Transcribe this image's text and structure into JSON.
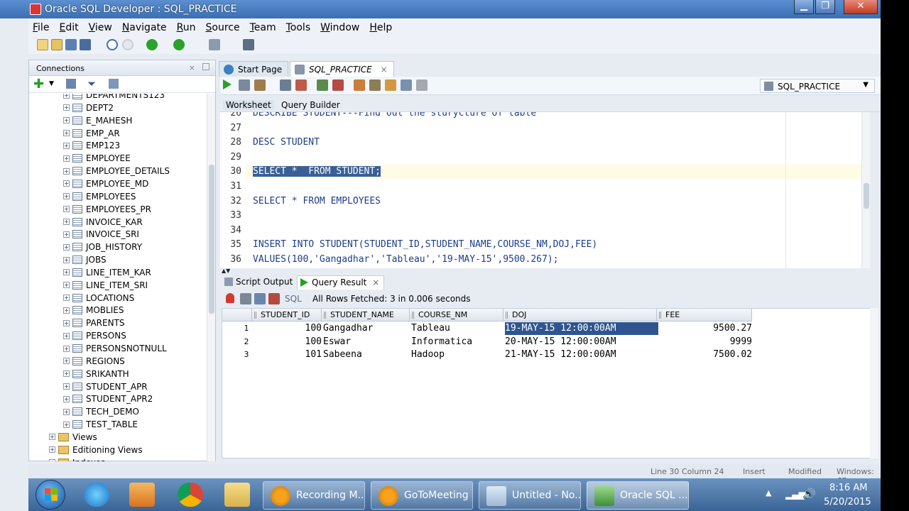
{
  "window": {
    "title": "Oracle SQL Developer : SQL_PRACTICE",
    "minimize": "▁",
    "maximize": "❐",
    "close": "✕"
  },
  "menu": [
    "File",
    "Edit",
    "View",
    "Navigate",
    "Run",
    "Source",
    "Team",
    "Tools",
    "Window",
    "Help"
  ],
  "connections": {
    "title": "Connections",
    "tree": [
      {
        "label": "DEPARTMENTS123",
        "type": "table"
      },
      {
        "label": "DEPT2",
        "type": "table"
      },
      {
        "label": "E_MAHESH",
        "type": "table"
      },
      {
        "label": "EMP_AR",
        "type": "table"
      },
      {
        "label": "EMP123",
        "type": "table"
      },
      {
        "label": "EMPLOYEE",
        "type": "table"
      },
      {
        "label": "EMPLOYEE_DETAILS",
        "type": "table"
      },
      {
        "label": "EMPLOYEE_MD",
        "type": "table"
      },
      {
        "label": "EMPLOYEES",
        "type": "table"
      },
      {
        "label": "EMPLOYEES_PR",
        "type": "table"
      },
      {
        "label": "INVOICE_KAR",
        "type": "table"
      },
      {
        "label": "INVOICE_SRI",
        "type": "table"
      },
      {
        "label": "JOB_HISTORY",
        "type": "table"
      },
      {
        "label": "JOBS",
        "type": "table"
      },
      {
        "label": "LINE_ITEM_KAR",
        "type": "table"
      },
      {
        "label": "LINE_ITEM_SRI",
        "type": "table"
      },
      {
        "label": "LOCATIONS",
        "type": "table"
      },
      {
        "label": "MOBLIES",
        "type": "table"
      },
      {
        "label": "PARENTS",
        "type": "table"
      },
      {
        "label": "PERSONS",
        "type": "table"
      },
      {
        "label": "PERSONSNOTNULL",
        "type": "table"
      },
      {
        "label": "REGIONS",
        "type": "table"
      },
      {
        "label": "SRIKANTH",
        "type": "table"
      },
      {
        "label": "STUDENT_APR",
        "type": "table"
      },
      {
        "label": "STUDENT_APR2",
        "type": "table"
      },
      {
        "label": "TECH_DEMO",
        "type": "table"
      },
      {
        "label": "TEST_TABLE",
        "type": "table"
      },
      {
        "label": "Views",
        "type": "folder"
      },
      {
        "label": "Editioning Views",
        "type": "folder"
      },
      {
        "label": "Indexes",
        "type": "folder"
      }
    ]
  },
  "tabs": [
    {
      "label": "Start Page"
    },
    {
      "label": "SQL_PRACTICE"
    }
  ],
  "connection_selector": "SQL_PRACTICE",
  "subtabs": {
    "worksheet": "Worksheet",
    "query_builder": "Query Builder"
  },
  "editor": {
    "lines": [
      {
        "n": "26",
        "text": "DESCRIBE STUDENT---Find out the sturycture of table"
      },
      {
        "n": "27",
        "text": ""
      },
      {
        "n": "28",
        "text": "DESC STUDENT"
      },
      {
        "n": "29",
        "text": ""
      },
      {
        "n": "30",
        "text": "SELECT *  FROM STUDENT;"
      },
      {
        "n": "31",
        "text": ""
      },
      {
        "n": "32",
        "text": "SELECT * FROM EMPLOYEES"
      },
      {
        "n": "33",
        "text": ""
      },
      {
        "n": "34",
        "text": ""
      },
      {
        "n": "35",
        "text": "INSERT INTO STUDENT(STUDENT_ID,STUDENT_NAME,COURSE_NM,DOJ,FEE)"
      },
      {
        "n": "36",
        "text": "VALUES(100,'Gangadhar','Tableau','19-MAY-15',9500.267);"
      }
    ]
  },
  "output_tabs": {
    "script_output": "Script Output",
    "query_result": "Query Result"
  },
  "result": {
    "sql_label": "SQL",
    "status": "All Rows Fetched: 3 in 0.006 seconds",
    "columns": [
      "STUDENT_ID",
      "STUDENT_NAME",
      "COURSE_NM",
      "DOJ",
      "FEE"
    ],
    "rows": [
      {
        "n": "1",
        "id": "100",
        "name": "Gangadhar",
        "course": "Tableau",
        "doj": "19-MAY-15 12:00:00AM",
        "fee": "9500.27"
      },
      {
        "n": "2",
        "id": "100",
        "name": "Eswar",
        "course": "Informatica",
        "doj": "20-MAY-15 12:00:00AM",
        "fee": "9999"
      },
      {
        "n": "3",
        "id": "101",
        "name": "Sabeena",
        "course": "Hadoop",
        "doj": "21-MAY-15 12:00:00AM",
        "fee": "7500.02"
      }
    ]
  },
  "statusbar": {
    "position": "Line 30 Column 24",
    "mode": "Insert",
    "modified": "Modified",
    "os": "Windows: CF"
  },
  "taskbar": {
    "tasks": [
      "Recording M...",
      "GoToMeeting",
      "Untitled - No...",
      "Oracle SQL ..."
    ],
    "time": "8:16 AM",
    "date": "5/20/2015"
  }
}
